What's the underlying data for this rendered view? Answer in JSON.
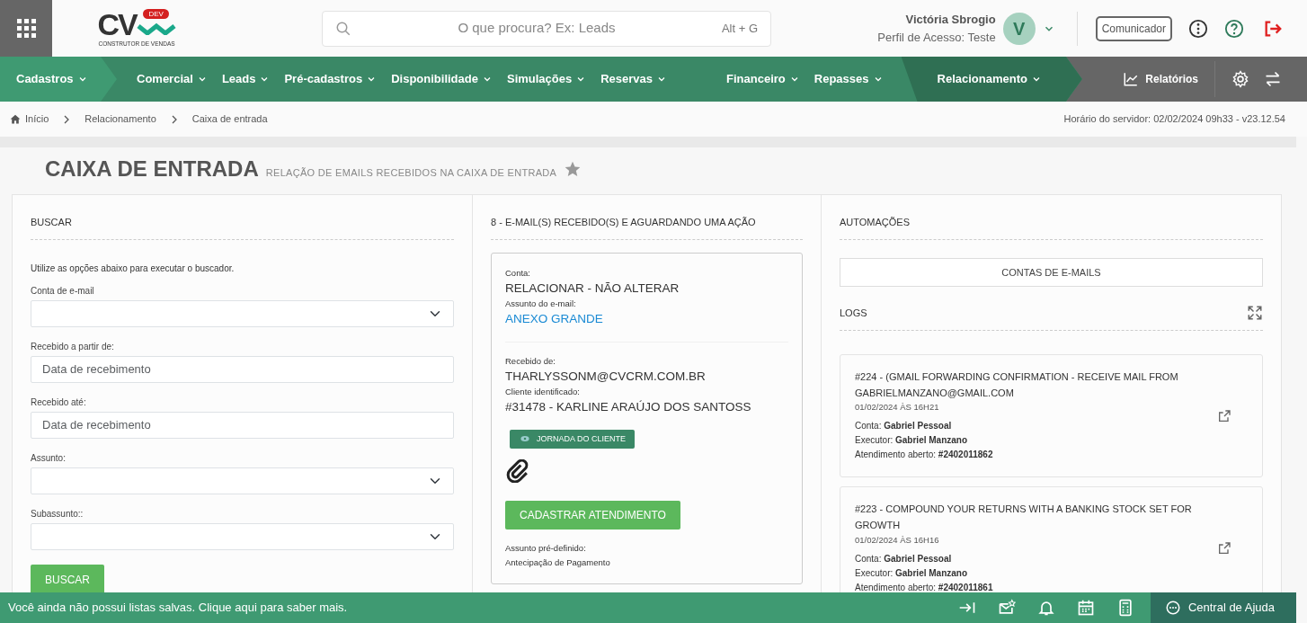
{
  "header": {
    "logo_text": "CV",
    "logo_badge": "DEV",
    "logo_caption": "CONSTRUTOR DE VENDAS",
    "search": {
      "placeholder": "O que procura? Ex: Leads",
      "shortcut": "Alt + G"
    },
    "user": {
      "name": "Victória Sbrogio",
      "profile": "Perfil de Acesso: Teste",
      "initial": "V"
    },
    "communicator": "Comunicador"
  },
  "nav_groups": [
    {
      "items": [
        {
          "label": "Cadastros",
          "selected": false
        }
      ]
    },
    {
      "items": [
        {
          "label": "Comercial",
          "selected": false
        },
        {
          "label": "Leads",
          "selected": false
        },
        {
          "label": "Pré-cadastros",
          "selected": false
        },
        {
          "label": "Disponibilidade",
          "selected": false
        },
        {
          "label": "Simulações",
          "selected": false
        },
        {
          "label": "Reservas",
          "selected": false
        },
        {
          "label": "Financeiro",
          "selected": false
        },
        {
          "label": "Repasses",
          "selected": false
        }
      ]
    },
    {
      "items": [
        {
          "label": "Relacionamento",
          "selected": true
        }
      ]
    }
  ],
  "nav_reports": "Relatórios",
  "breadcrumb": [
    "Início",
    "Relacionamento",
    "Caixa de entrada"
  ],
  "server_time": "Horário do servidor: 02/02/2024 09h33 - v23.12.54",
  "page": {
    "title": "CAIXA DE ENTRADA",
    "subtitle": "RELAÇÃO DE EMAILS RECEBIDOS NA CAIXA DE ENTRADA",
    "favorite": false
  },
  "search_panel": {
    "heading": "BUSCAR",
    "intro": "Utilize as opções abaixo para executar o buscador.",
    "fields": [
      {
        "kind": "select",
        "label": "Conta de e-mail"
      },
      {
        "kind": "text",
        "label": "Recebido a partir de:",
        "placeholder": "Data de recebimento"
      },
      {
        "kind": "text",
        "label": "Recebido até:",
        "placeholder": "Data de recebimento"
      },
      {
        "kind": "select",
        "label": "Assunto:"
      },
      {
        "kind": "select",
        "label": "Subassunto::"
      }
    ],
    "button": "BUSCAR"
  },
  "inbox": {
    "heading": "8 - E-MAIL(S) RECEBIDO(S) E AGUARDANDO UMA AÇÃO",
    "email": {
      "account_label": "Conta:",
      "account": "RELACIONAR - NÃO ALTERAR",
      "subject_label": "Assunto do e-mail:",
      "subject": "ANEXO GRANDE",
      "from_label": "Recebido de:",
      "from": "THARLYSSONM@CVCRM.COM.BR",
      "client_label": "Cliente identificado:",
      "client": "#31478 - KARLINE ARAÚJO DOS SANTOSS",
      "journey": "JORNADA DO CLIENTE",
      "has_attachment": true,
      "register_button": "CADASTRAR ATENDIMENTO",
      "preset_label": "Assunto pré-definido:",
      "preset": "Antecipação de Pagamento"
    }
  },
  "automations": {
    "heading": "AUTOMAÇÕES",
    "accounts_button": "CONTAS DE E-MAILS",
    "logs_heading": "LOGS",
    "logs": [
      {
        "title": "#224 - (GMAIL FORWARDING CONFIRMATION - RECEIVE MAIL FROM GABRIELMANZANO@GMAIL.COM",
        "date": "01/02/2024 ÀS 16H21",
        "fields": [
          {
            "label": "Conta:",
            "value": "Gabriel Pessoal"
          },
          {
            "label": "Executor:",
            "value": "Gabriel Manzano"
          },
          {
            "label": "Atendimento aberto:",
            "value": "#2402011862"
          }
        ]
      },
      {
        "title": "#223 - COMPOUND YOUR RETURNS WITH A BANKING STOCK SET FOR GROWTH",
        "date": "01/02/2024 ÀS 16H16",
        "fields": [
          {
            "label": "Conta:",
            "value": "Gabriel Pessoal"
          },
          {
            "label": "Executor:",
            "value": "Gabriel Manzano"
          },
          {
            "label": "Atendimento aberto:",
            "value": "#2402011861"
          }
        ]
      }
    ]
  },
  "footer": {
    "message": "Você ainda não possui listas salvas. Clique aqui para saber mais.",
    "help": "Central de Ajuda"
  }
}
